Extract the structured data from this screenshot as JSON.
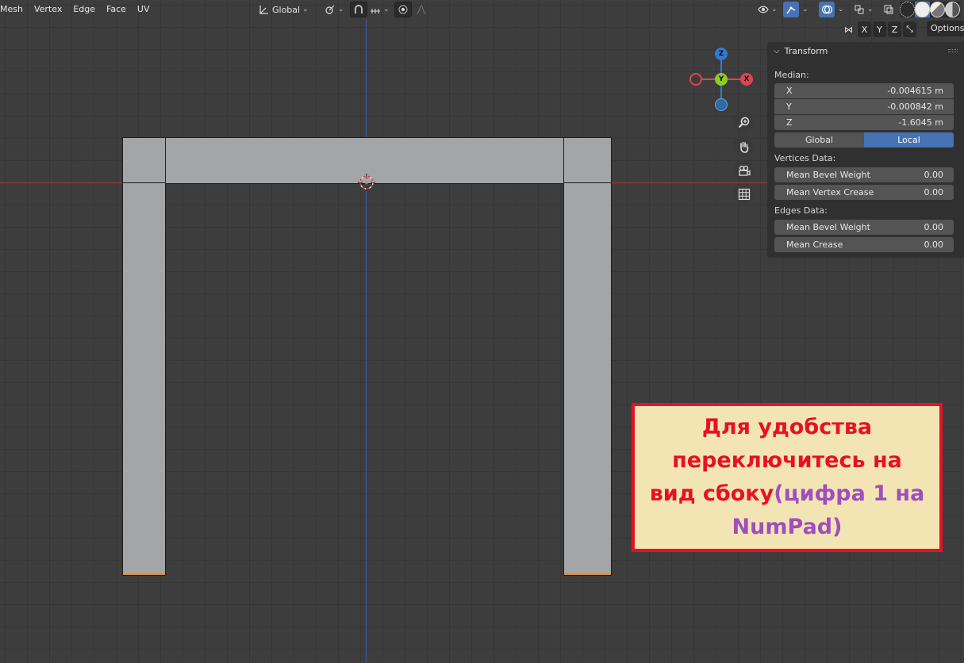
{
  "menu": {
    "items": [
      "Mesh",
      "Vertex",
      "Edge",
      "Face",
      "UV"
    ]
  },
  "header": {
    "orientation": "Global",
    "options_label": "Options",
    "axes": [
      "X",
      "Y",
      "Z"
    ]
  },
  "gizmo": {
    "z": "Z",
    "y": "Y",
    "x": "X",
    "colors": {
      "x": "#e0454e",
      "y": "#8ccc22",
      "z": "#2f7ad4"
    }
  },
  "transform_panel": {
    "title": "Transform",
    "median_label": "Median:",
    "x_label": "X",
    "x_value": "-0.004615 m",
    "y_label": "Y",
    "y_value": "-0.000842 m",
    "z_label": "Z",
    "z_value": "-1.6045 m",
    "space_global": "Global",
    "space_local": "Local",
    "vertices_data_label": "Vertices Data:",
    "mean_bevel_weight_v_label": "Mean Bevel Weight",
    "mean_bevel_weight_v_value": "0.00",
    "mean_vertex_crease_label": "Mean Vertex Crease",
    "mean_vertex_crease_value": "0.00",
    "edges_data_label": "Edges Data:",
    "mean_bevel_weight_e_label": "Mean Bevel Weight",
    "mean_bevel_weight_e_value": "0.00",
    "mean_crease_label": "Mean Crease",
    "mean_crease_value": "0.00"
  },
  "annotation": {
    "line1": "Для удобства",
    "line2": "переключитесь на",
    "line3": "вид сбоку",
    "line3_hint": "(цифра 1 на",
    "line4": "NumPad)"
  },
  "colors": {
    "accent": "#4772b3",
    "annotation_red": "#e81123",
    "annotation_purple": "#9f4fbd",
    "annotation_bg": "#f3e5b3"
  }
}
